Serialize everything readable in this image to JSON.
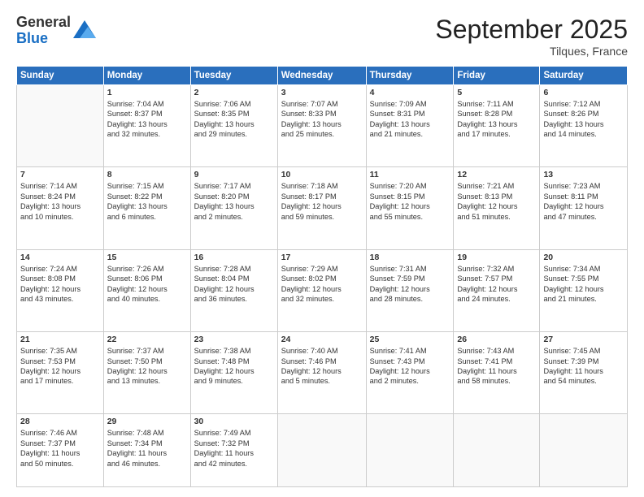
{
  "logo": {
    "general": "General",
    "blue": "Blue"
  },
  "header": {
    "month": "September 2025",
    "location": "Tilques, France"
  },
  "days": [
    "Sunday",
    "Monday",
    "Tuesday",
    "Wednesday",
    "Thursday",
    "Friday",
    "Saturday"
  ],
  "weeks": [
    [
      {
        "day": "",
        "content": ""
      },
      {
        "day": "1",
        "content": "Sunrise: 7:04 AM\nSunset: 8:37 PM\nDaylight: 13 hours\nand 32 minutes."
      },
      {
        "day": "2",
        "content": "Sunrise: 7:06 AM\nSunset: 8:35 PM\nDaylight: 13 hours\nand 29 minutes."
      },
      {
        "day": "3",
        "content": "Sunrise: 7:07 AM\nSunset: 8:33 PM\nDaylight: 13 hours\nand 25 minutes."
      },
      {
        "day": "4",
        "content": "Sunrise: 7:09 AM\nSunset: 8:31 PM\nDaylight: 13 hours\nand 21 minutes."
      },
      {
        "day": "5",
        "content": "Sunrise: 7:11 AM\nSunset: 8:28 PM\nDaylight: 13 hours\nand 17 minutes."
      },
      {
        "day": "6",
        "content": "Sunrise: 7:12 AM\nSunset: 8:26 PM\nDaylight: 13 hours\nand 14 minutes."
      }
    ],
    [
      {
        "day": "7",
        "content": "Sunrise: 7:14 AM\nSunset: 8:24 PM\nDaylight: 13 hours\nand 10 minutes."
      },
      {
        "day": "8",
        "content": "Sunrise: 7:15 AM\nSunset: 8:22 PM\nDaylight: 13 hours\nand 6 minutes."
      },
      {
        "day": "9",
        "content": "Sunrise: 7:17 AM\nSunset: 8:20 PM\nDaylight: 13 hours\nand 2 minutes."
      },
      {
        "day": "10",
        "content": "Sunrise: 7:18 AM\nSunset: 8:17 PM\nDaylight: 12 hours\nand 59 minutes."
      },
      {
        "day": "11",
        "content": "Sunrise: 7:20 AM\nSunset: 8:15 PM\nDaylight: 12 hours\nand 55 minutes."
      },
      {
        "day": "12",
        "content": "Sunrise: 7:21 AM\nSunset: 8:13 PM\nDaylight: 12 hours\nand 51 minutes."
      },
      {
        "day": "13",
        "content": "Sunrise: 7:23 AM\nSunset: 8:11 PM\nDaylight: 12 hours\nand 47 minutes."
      }
    ],
    [
      {
        "day": "14",
        "content": "Sunrise: 7:24 AM\nSunset: 8:08 PM\nDaylight: 12 hours\nand 43 minutes."
      },
      {
        "day": "15",
        "content": "Sunrise: 7:26 AM\nSunset: 8:06 PM\nDaylight: 12 hours\nand 40 minutes."
      },
      {
        "day": "16",
        "content": "Sunrise: 7:28 AM\nSunset: 8:04 PM\nDaylight: 12 hours\nand 36 minutes."
      },
      {
        "day": "17",
        "content": "Sunrise: 7:29 AM\nSunset: 8:02 PM\nDaylight: 12 hours\nand 32 minutes."
      },
      {
        "day": "18",
        "content": "Sunrise: 7:31 AM\nSunset: 7:59 PM\nDaylight: 12 hours\nand 28 minutes."
      },
      {
        "day": "19",
        "content": "Sunrise: 7:32 AM\nSunset: 7:57 PM\nDaylight: 12 hours\nand 24 minutes."
      },
      {
        "day": "20",
        "content": "Sunrise: 7:34 AM\nSunset: 7:55 PM\nDaylight: 12 hours\nand 21 minutes."
      }
    ],
    [
      {
        "day": "21",
        "content": "Sunrise: 7:35 AM\nSunset: 7:53 PM\nDaylight: 12 hours\nand 17 minutes."
      },
      {
        "day": "22",
        "content": "Sunrise: 7:37 AM\nSunset: 7:50 PM\nDaylight: 12 hours\nand 13 minutes."
      },
      {
        "day": "23",
        "content": "Sunrise: 7:38 AM\nSunset: 7:48 PM\nDaylight: 12 hours\nand 9 minutes."
      },
      {
        "day": "24",
        "content": "Sunrise: 7:40 AM\nSunset: 7:46 PM\nDaylight: 12 hours\nand 5 minutes."
      },
      {
        "day": "25",
        "content": "Sunrise: 7:41 AM\nSunset: 7:43 PM\nDaylight: 12 hours\nand 2 minutes."
      },
      {
        "day": "26",
        "content": "Sunrise: 7:43 AM\nSunset: 7:41 PM\nDaylight: 11 hours\nand 58 minutes."
      },
      {
        "day": "27",
        "content": "Sunrise: 7:45 AM\nSunset: 7:39 PM\nDaylight: 11 hours\nand 54 minutes."
      }
    ],
    [
      {
        "day": "28",
        "content": "Sunrise: 7:46 AM\nSunset: 7:37 PM\nDaylight: 11 hours\nand 50 minutes."
      },
      {
        "day": "29",
        "content": "Sunrise: 7:48 AM\nSunset: 7:34 PM\nDaylight: 11 hours\nand 46 minutes."
      },
      {
        "day": "30",
        "content": "Sunrise: 7:49 AM\nSunset: 7:32 PM\nDaylight: 11 hours\nand 42 minutes."
      },
      {
        "day": "",
        "content": ""
      },
      {
        "day": "",
        "content": ""
      },
      {
        "day": "",
        "content": ""
      },
      {
        "day": "",
        "content": ""
      }
    ]
  ]
}
